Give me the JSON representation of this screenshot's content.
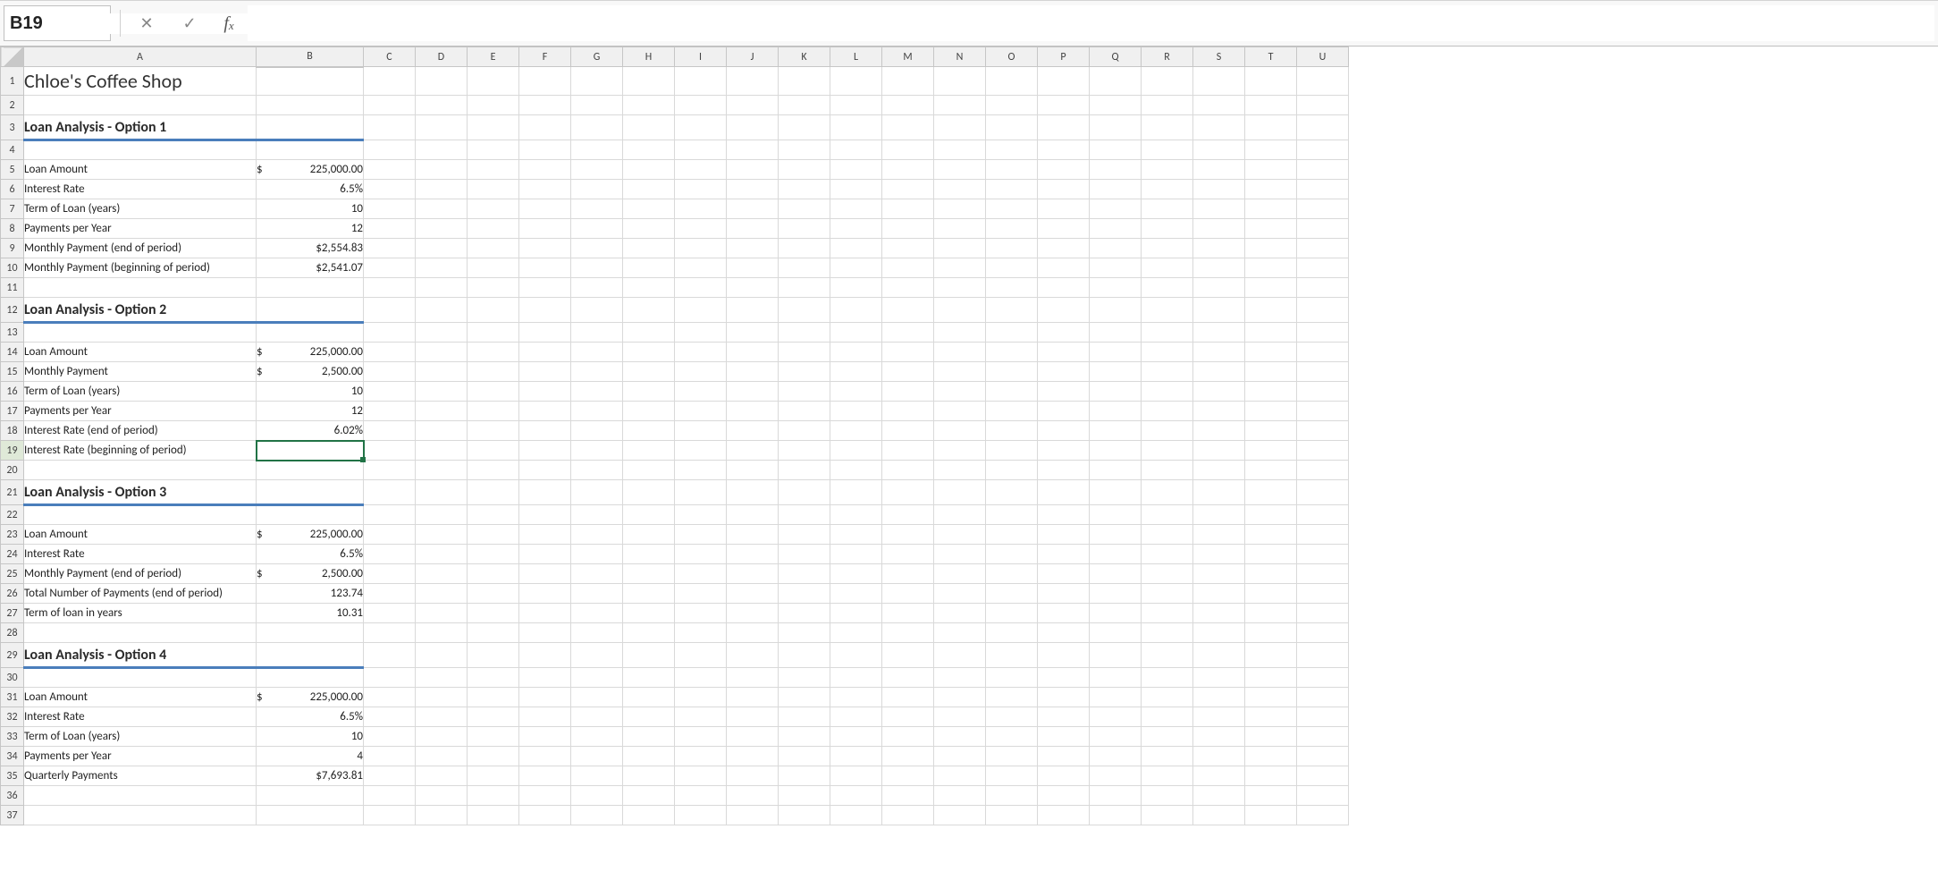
{
  "name_box": "B19",
  "formula_input": "",
  "col_headers": [
    "A",
    "B",
    "C",
    "D",
    "E",
    "F",
    "G",
    "H",
    "I",
    "J",
    "K",
    "L",
    "M",
    "N",
    "O",
    "P",
    "Q",
    "R",
    "S",
    "T",
    "U"
  ],
  "col_widths": {
    "A": 260,
    "B": 120
  },
  "std_col_width": 58,
  "row_count": 37,
  "selected_cell": {
    "col": "B",
    "row": 19
  },
  "title": "Chloe's Coffee Shop",
  "sections": [
    {
      "row": 3,
      "heading": "Loan Analysis - Option 1",
      "rows": [
        {
          "row": 5,
          "label": "Loan Amount",
          "currency": "$",
          "value": "225,000.00"
        },
        {
          "row": 6,
          "label": "Interest Rate",
          "value": "6.5%"
        },
        {
          "row": 7,
          "label": "Term of Loan (years)",
          "value": "10"
        },
        {
          "row": 8,
          "label": "Payments per Year",
          "value": "12"
        },
        {
          "row": 9,
          "label": "Monthly Payment (end of period)",
          "value": "$2,554.83"
        },
        {
          "row": 10,
          "label": "Monthly Payment (beginning of period)",
          "value": "$2,541.07"
        }
      ]
    },
    {
      "row": 12,
      "heading": "Loan Analysis - Option 2",
      "rows": [
        {
          "row": 14,
          "label": "Loan Amount",
          "currency": "$",
          "value": "225,000.00"
        },
        {
          "row": 15,
          "label": "Monthly Payment",
          "currency": "$",
          "value": "2,500.00"
        },
        {
          "row": 16,
          "label": "Term of Loan (years)",
          "value": "10"
        },
        {
          "row": 17,
          "label": "Payments per Year",
          "value": "12"
        },
        {
          "row": 18,
          "label": "Interest Rate (end of period)",
          "value": "6.02%"
        },
        {
          "row": 19,
          "label": "Interest Rate (beginning of period)",
          "value": ""
        }
      ]
    },
    {
      "row": 21,
      "heading": "Loan Analysis - Option 3",
      "rows": [
        {
          "row": 23,
          "label": "Loan Amount",
          "currency": "$",
          "value": "225,000.00"
        },
        {
          "row": 24,
          "label": "Interest Rate",
          "value": "6.5%"
        },
        {
          "row": 25,
          "label": "Monthly Payment (end of period)",
          "currency": "$",
          "value": "2,500.00"
        },
        {
          "row": 26,
          "label": "Total Number of Payments (end of period)",
          "value": "123.74"
        },
        {
          "row": 27,
          "label": "Term of loan in years",
          "value": "10.31"
        }
      ]
    },
    {
      "row": 29,
      "heading": "Loan Analysis - Option 4",
      "rows": [
        {
          "row": 31,
          "label": "Loan Amount",
          "currency": "$",
          "value": "225,000.00"
        },
        {
          "row": 32,
          "label": "Interest Rate",
          "value": "6.5%"
        },
        {
          "row": 33,
          "label": "Term of Loan (years)",
          "value": "10"
        },
        {
          "row": 34,
          "label": "Payments per Year",
          "value": "4"
        },
        {
          "row": 35,
          "label": "Quarterly Payments",
          "value": "$7,693.81"
        }
      ]
    }
  ]
}
